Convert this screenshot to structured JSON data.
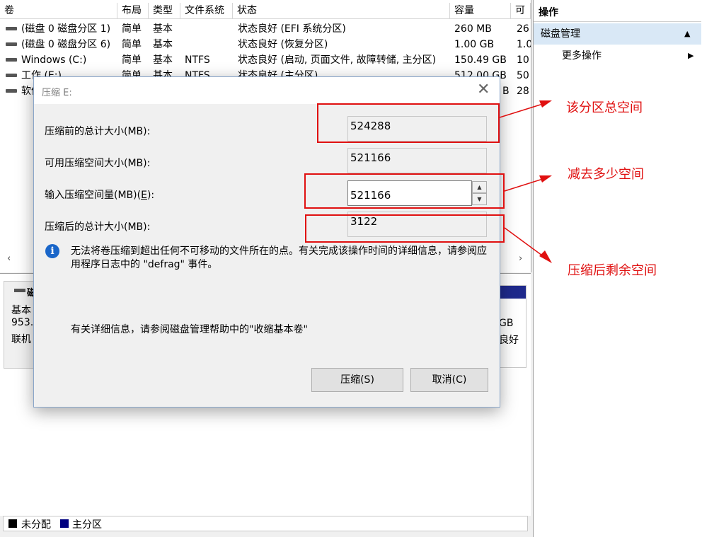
{
  "volume_table": {
    "headers": [
      "卷",
      "布局",
      "类型",
      "文件系统",
      "状态",
      "容量",
      "可"
    ],
    "rows": [
      [
        "(磁盘 0 磁盘分区 1)",
        "简单",
        "基本",
        "",
        "状态良好 (EFI 系统分区)",
        "260 MB",
        "26"
      ],
      [
        "(磁盘 0 磁盘分区 6)",
        "简单",
        "基本",
        "",
        "状态良好 (恢复分区)",
        "1.00 GB",
        "1.0"
      ],
      [
        "Windows (C:)",
        "简单",
        "基本",
        "NTFS",
        "状态良好 (启动, 页面文件, 故障转储, 主分区)",
        "150.49 GB",
        "10"
      ],
      [
        "工作 (E:)",
        "简单",
        "基本",
        "NTFS",
        "状态良好 (主分区)",
        "512.00 GB",
        "50"
      ],
      [
        "软件",
        "",
        "",
        "",
        "",
        "B",
        "28"
      ]
    ],
    "scroll_left": "‹",
    "scroll_right": "›"
  },
  "disk_graph": {
    "disk_label": "磁",
    "line1": "基本",
    "line2": "953.",
    "line3": "联机",
    "right_size": "GB",
    "right_status": "良好"
  },
  "legend": [
    {
      "label": "未分配",
      "color": "#000000"
    },
    {
      "label": "主分区",
      "color": "#000080"
    }
  ],
  "actions": {
    "title": "操作",
    "section": "磁盘管理",
    "section_arrow": "▲",
    "more": "更多操作",
    "more_arrow": "▶"
  },
  "dialog": {
    "title": "压缩 E:",
    "close": "✕",
    "total_before_label": "压缩前的总计大小(MB):",
    "total_before_value": "524288",
    "available_label": "可用压缩空间大小(MB):",
    "available_value": "521166",
    "input_label": "输入压缩空间量(MB)(",
    "input_label_key": "E",
    "input_label_end": "):",
    "input_value": "521166",
    "spin_up": "▲",
    "spin_down": "▼",
    "total_after_label": "压缩后的总计大小(MB):",
    "total_after_value": "3122",
    "info_icon": "i",
    "info_text": "无法将卷压缩到超出任何不可移动的文件所在的点。有关完成该操作时间的详细信息，请参阅应用程序日志中的 \"defrag\" 事件。",
    "help_text": "有关详细信息，请参阅磁盘管理帮助中的\"收缩基本卷\"",
    "shrink_button": "压缩(S)",
    "cancel_button": "取消(C)"
  },
  "annotations": {
    "total_space": "该分区总空间",
    "reduce_space": "减去多少空间",
    "remaining_space": "压缩后剩余空间",
    "color": "#e01010"
  }
}
